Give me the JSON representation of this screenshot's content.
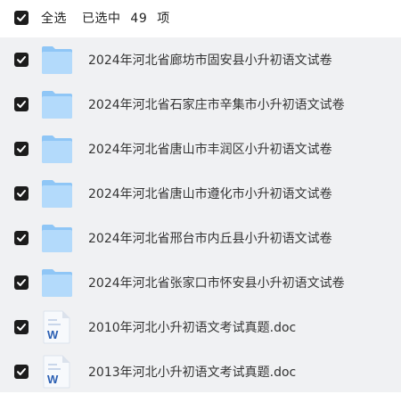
{
  "header": {
    "select_all_label": "全选",
    "selected_prefix": "已选中",
    "selected_count": "49",
    "selected_suffix": "项"
  },
  "items": [
    {
      "type": "folder",
      "name": "2024年河北省廊坊市固安县小升初语文试卷",
      "checked": true
    },
    {
      "type": "folder",
      "name": "2024年河北省石家庄市辛集市小升初语文试卷",
      "checked": true
    },
    {
      "type": "folder",
      "name": "2024年河北省唐山市丰润区小升初语文试卷",
      "checked": true
    },
    {
      "type": "folder",
      "name": "2024年河北省唐山市遵化市小升初语文试卷",
      "checked": true
    },
    {
      "type": "folder",
      "name": "2024年河北省邢台市内丘县小升初语文试卷",
      "checked": true
    },
    {
      "type": "folder",
      "name": "2024年河北省张家口市怀安县小升初语文试卷",
      "checked": true
    },
    {
      "type": "word-doc",
      "name": "2010年河北小升初语文考试真题.doc",
      "checked": true
    },
    {
      "type": "word-doc",
      "name": "2013年河北小升初语文考试真题.doc",
      "checked": true
    }
  ],
  "colors": {
    "folder_back": "#8fc6f6",
    "folder_front": "#b3dafb",
    "word_blue": "#2b5fb3",
    "checkbox": "#1c1c1c",
    "list_bg": "#f0f1f3"
  }
}
